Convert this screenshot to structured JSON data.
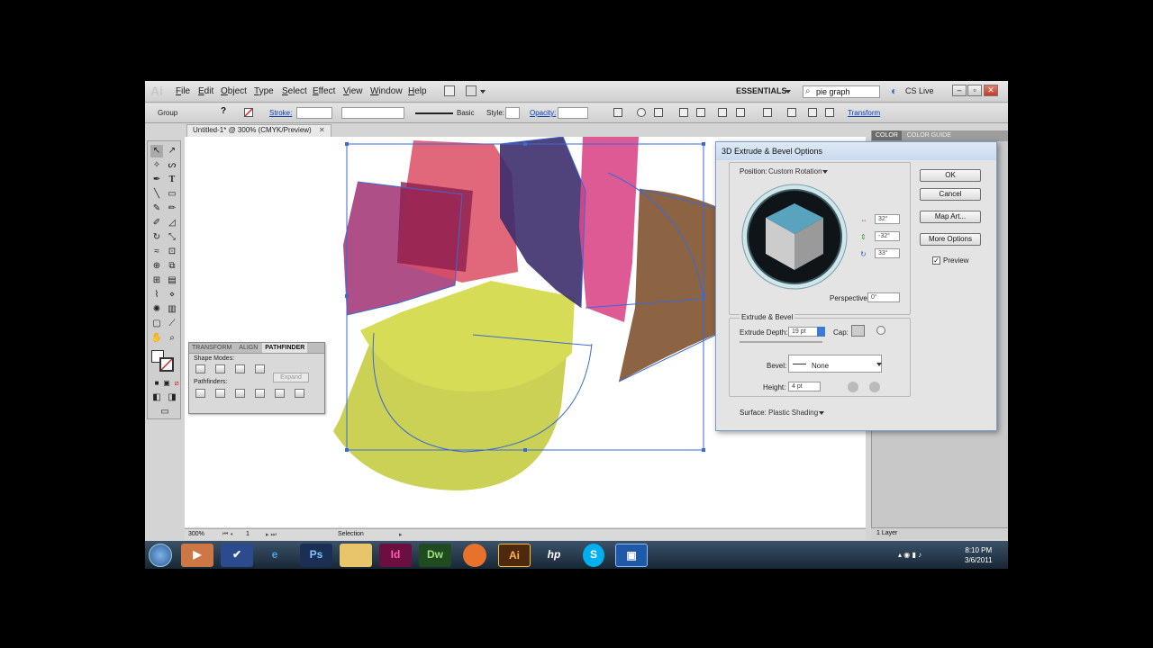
{
  "menubar": {
    "logo": "Ai",
    "items": [
      "File",
      "Edit",
      "Object",
      "Type",
      "Select",
      "Effect",
      "View",
      "Window",
      "Help"
    ],
    "workspace": "ESSENTIALS",
    "search_value": "pie graph",
    "cs_live": "CS Live"
  },
  "controlbar": {
    "selection_type": "Group",
    "stroke_label": "Stroke:",
    "brush_label": "Basic",
    "style_label": "Style:",
    "opacity_label": "Opacity:",
    "transform_label": "Transform"
  },
  "document": {
    "tab_title": "Untitled-1* @ 300% (CMYK/Preview)"
  },
  "status": {
    "zoom": "300%",
    "page": "1",
    "tool": "Selection"
  },
  "pathfinder": {
    "tabs": [
      "TRANSFORM",
      "ALIGN",
      "PATHFINDER"
    ],
    "active_tab": "PATHFINDER",
    "shape_modes_label": "Shape Modes:",
    "pathfinders_label": "Pathfinders:",
    "expand_label": "Expand"
  },
  "dock": {
    "tabs": [
      "COLOR",
      "COLOR GUIDE"
    ],
    "layers_label": "1 Layer"
  },
  "dialog": {
    "title": "3D Extrude & Bevel Options",
    "position_label": "Position:",
    "position_value": "Custom Rotation",
    "rot_x": "32°",
    "rot_y": "-32°",
    "rot_z": "33°",
    "perspective_label": "Perspective:",
    "perspective_value": "0°",
    "extrude_section": "Extrude & Bevel",
    "extrude_depth_label": "Extrude Depth:",
    "extrude_depth_value": "19 pt",
    "cap_label": "Cap:",
    "bevel_label": "Bevel:",
    "bevel_value": "None",
    "height_label": "Height:",
    "height_value": "4 pt",
    "surface_label": "Surface:",
    "surface_value": "Plastic Shading",
    "ok_label": "OK",
    "cancel_label": "Cancel",
    "map_art_label": "Map Art...",
    "more_options_label": "More Options",
    "preview_label": "Preview",
    "preview_checked": true
  },
  "taskbar": {
    "apps": [
      "Ps",
      "Id",
      "Dw",
      "Ai"
    ],
    "time": "8:10 PM",
    "date": "3/6/2011"
  },
  "colors": {
    "yellow_slice": "#cdd44a",
    "pink_slice": "#d9457f",
    "magenta_slice": "#a63a78",
    "red_slice": "#de4a5e",
    "navy_slice": "#3d2e6b",
    "brown_slice": "#8a6444",
    "selection_blue": "#3a6ad6"
  }
}
